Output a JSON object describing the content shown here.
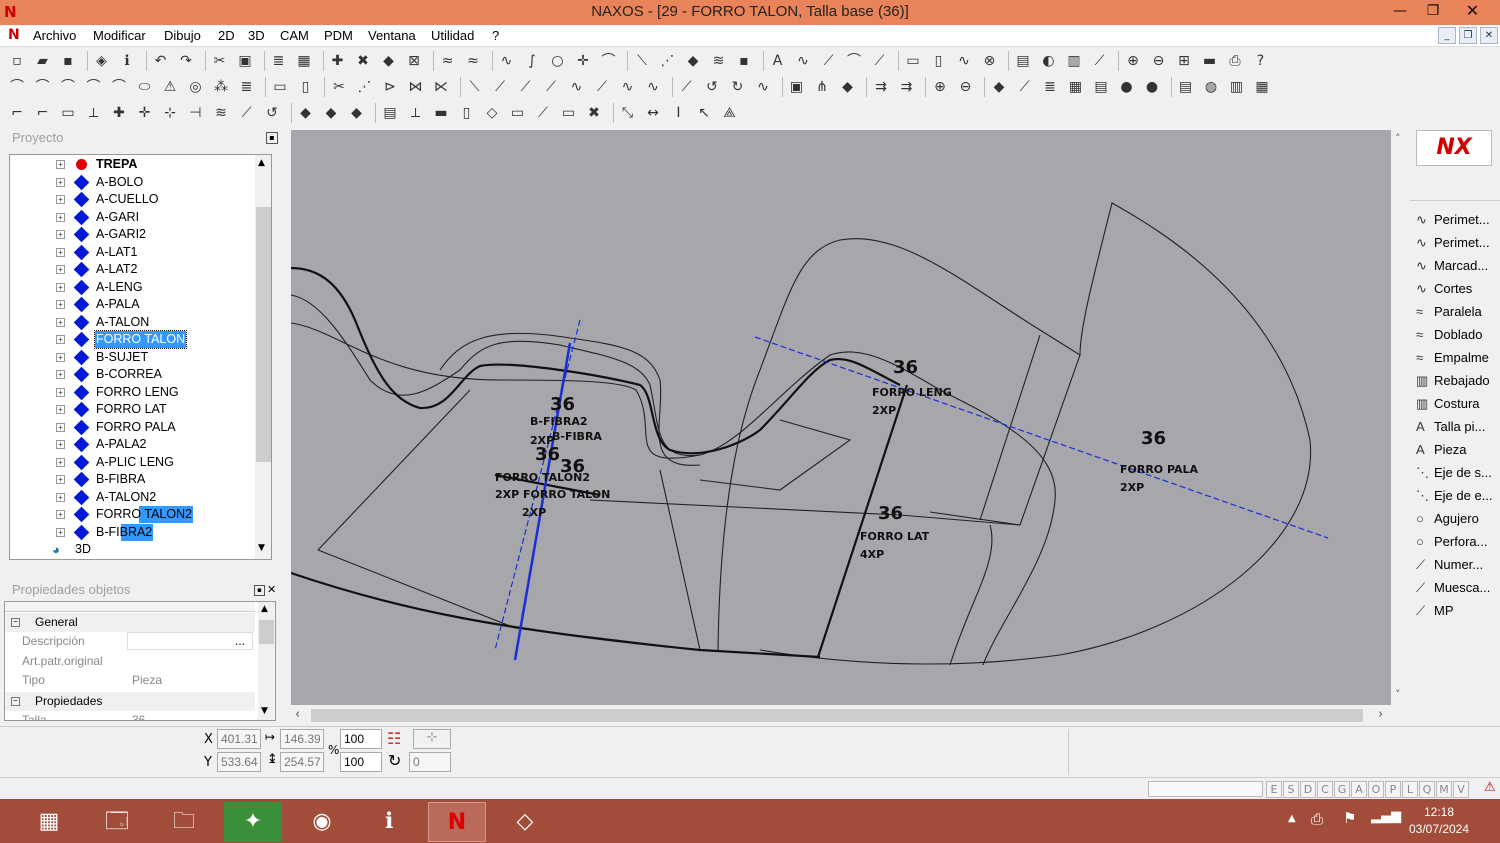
{
  "window": {
    "title": "NAXOS - [29 - FORRO TALON, Talla base (36)]",
    "app_icon": "N",
    "minimize": "—",
    "restore": "❐",
    "close": "✕"
  },
  "menu": [
    "Archivo",
    "Modificar",
    "Dibujo",
    "2D",
    "3D",
    "CAM",
    "PDM",
    "Ventana",
    "Utilidad",
    "?"
  ],
  "project_panel": {
    "title": "Proyecto"
  },
  "tree": [
    {
      "label": "TREPA",
      "type": "root"
    },
    {
      "label": "A-BOLO"
    },
    {
      "label": "A-CUELLO"
    },
    {
      "label": "A-GARI"
    },
    {
      "label": "A-GARI2"
    },
    {
      "label": "A-LAT1"
    },
    {
      "label": "A-LAT2"
    },
    {
      "label": "A-LENG"
    },
    {
      "label": "A-PALA"
    },
    {
      "label": "A-TALON"
    },
    {
      "label": "FORRO TALON",
      "selected": true
    },
    {
      "label": "B-SUJET"
    },
    {
      "label": "B-CORREA"
    },
    {
      "label": "FORRO LENG"
    },
    {
      "label": "FORRO LAT"
    },
    {
      "label": "FORRO PALA"
    },
    {
      "label": "A-PALA2"
    },
    {
      "label": "A-PLIC LENG"
    },
    {
      "label": "B-FIBRA"
    },
    {
      "label": "A-TALON2"
    },
    {
      "label": "FORRO TALON2",
      "partial_sel": true
    },
    {
      "label": "B-FIBRA2",
      "partial_sel": true
    },
    {
      "label": "3D",
      "type": "3d"
    }
  ],
  "props_panel": {
    "title": "Propiedades objetos"
  },
  "props": {
    "general": "General",
    "descripcion_label": "Descripción",
    "art_label": "Art.patr.original",
    "tipo_label": "Tipo",
    "tipo_value": "Pieza",
    "propiedades": "Propiedades",
    "talla_label": "Talla",
    "talla_value": "36"
  },
  "right_tools": [
    "Perimet...",
    "Perimet...",
    "Marcad...",
    "Cortes",
    "Paralela",
    "Doblado",
    "Empalme",
    "Rebajado",
    "Costura",
    "Talla pi...",
    "Pieza",
    "Eje de s...",
    "Eje de e...",
    "Agujero",
    "Perfora...",
    "Numer...",
    "Muesca...",
    "MP"
  ],
  "right_icons": [
    "curve-icon",
    "curve-icon",
    "curve-icon",
    "curve-icon",
    "parallel-icon",
    "fold-icon",
    "join-icon",
    "bevel-icon",
    "seam-icon",
    "text-icon",
    "text-icon",
    "axis-icon",
    "axis-icon",
    "hole-icon",
    "hole-icon",
    "number-icon",
    "notch-icon",
    "mp-icon"
  ],
  "drawing_labels": [
    {
      "text": "36",
      "kind": "size"
    },
    {
      "text": "FORRO LENG",
      "kind": "name"
    },
    {
      "text": "2XP",
      "kind": "qty"
    },
    {
      "text": "36",
      "kind": "size"
    },
    {
      "text": "FORRO PALA",
      "kind": "name"
    },
    {
      "text": "2XP",
      "kind": "qty"
    },
    {
      "text": "36",
      "kind": "size"
    },
    {
      "text": "FORRO LAT",
      "kind": "name"
    },
    {
      "text": "4XP",
      "kind": "qty"
    },
    {
      "text": "36",
      "kind": "size"
    },
    {
      "text": "B-FIBRA2",
      "kind": "name"
    },
    {
      "text": "2XP",
      "kind": "qty"
    },
    {
      "text": "B-FIBRA",
      "kind": "name"
    },
    {
      "text": "36",
      "kind": "size"
    },
    {
      "text": "36",
      "kind": "size"
    },
    {
      "text": "FORRO TALON2",
      "kind": "name"
    },
    {
      "text": "2XP FORRO TALON",
      "kind": "name"
    },
    {
      "text": "2XP",
      "kind": "qty"
    }
  ],
  "status": {
    "x_label": "X",
    "x_value": "401.31",
    "dx_value": "146.39",
    "y_label": "Y",
    "y_value": "533.64",
    "dy_value": "254.57",
    "scale1": "100",
    "scale2": "100",
    "pct": "%",
    "angle": "0"
  },
  "status_letters": [
    "E",
    "S",
    "D",
    "C",
    "G",
    "A",
    "O",
    "P",
    "L",
    "Q",
    "M",
    "V"
  ],
  "clock": {
    "time": "12:18",
    "date": "03/07/2024"
  },
  "logo_text": "NX"
}
